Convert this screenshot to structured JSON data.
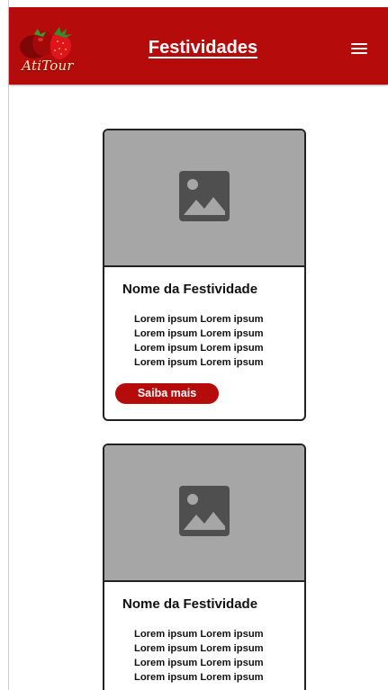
{
  "header": {
    "logo_text": "AtiTour",
    "title": "Festividades",
    "menu_icon": "hamburger-menu-icon"
  },
  "cards": [
    {
      "title": "Nome da Festividade",
      "lines": [
        "Lorem ipsum Lorem ipsum",
        "Lorem ipsum Lorem ipsum",
        "Lorem ipsum Lorem ipsum",
        "Lorem ipsum Lorem ipsum"
      ],
      "button_label": "Saiba mais",
      "image_icon": "image-placeholder-icon"
    },
    {
      "title": "Nome da Festividade",
      "lines": [
        "Lorem ipsum Lorem ipsum",
        "Lorem ipsum Lorem ipsum",
        "Lorem ipsum Lorem ipsum",
        "Lorem ipsum Lorem ipsum"
      ],
      "image_icon": "image-placeholder-icon"
    }
  ],
  "colors": {
    "brand_red": "#b50b0b",
    "placeholder_gray": "#a6a6a6",
    "icon_gray": "#4f4f4f"
  }
}
